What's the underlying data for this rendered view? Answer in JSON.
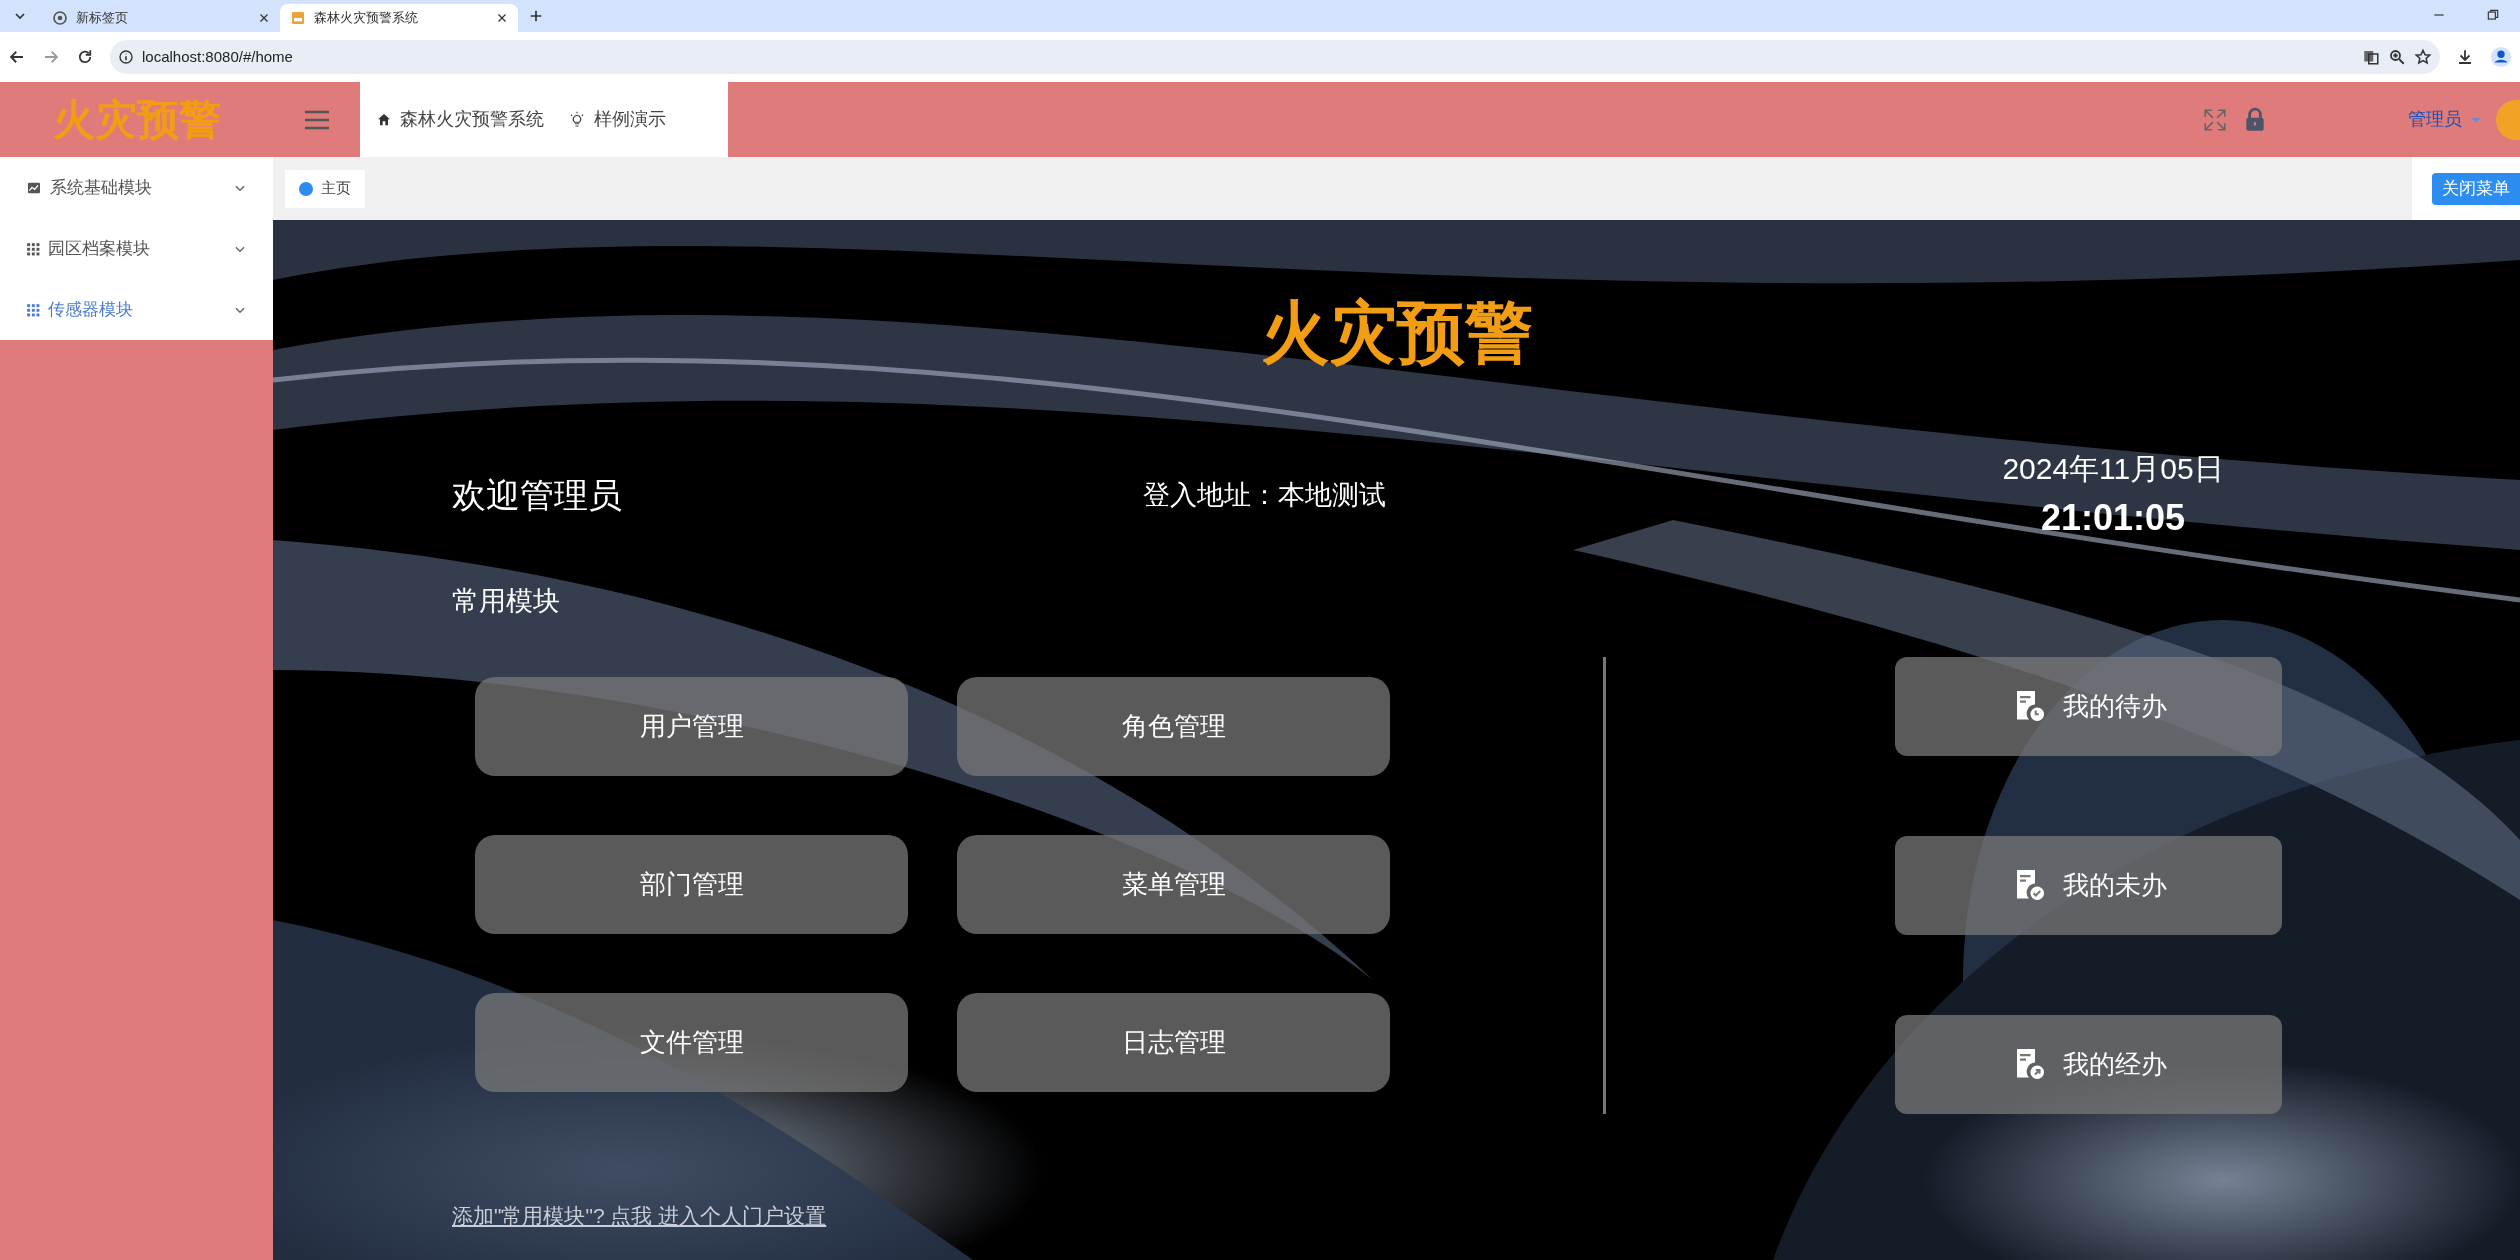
{
  "browser": {
    "tabs": [
      {
        "title": "新标签页",
        "selected": false
      },
      {
        "title": "森林火灾预警系统",
        "selected": true
      }
    ],
    "address": "localhost:8080/#/home"
  },
  "header": {
    "logo": "火灾预警",
    "tabs": [
      {
        "label": "森林火灾预警系统",
        "kind": "home"
      },
      {
        "label": "样例演示",
        "kind": "bulb"
      }
    ],
    "user": "管理员"
  },
  "tag_bar": {
    "tags": [
      {
        "label": "主页",
        "selected": true
      }
    ],
    "close_menu": "关闭菜单"
  },
  "sidebar": {
    "items": [
      {
        "label": "系统基础模块",
        "kind": "chart",
        "selected": false
      },
      {
        "label": "园区档案模块",
        "kind": "grid",
        "selected": false
      },
      {
        "label": "传感器模块",
        "kind": "grid",
        "selected": true
      }
    ]
  },
  "home": {
    "title": "火灾预警",
    "welcome": "欢迎管理员",
    "login_address": "登入地址：本地测试",
    "date": "2024年11月05日",
    "time": "21:01:05",
    "section_title": "常用模块",
    "modules": [
      "用户管理",
      "角色管理",
      "部门管理",
      "菜单管理",
      "文件管理",
      "日志管理"
    ],
    "tasks": [
      {
        "label": "我的待办",
        "kind": "clock"
      },
      {
        "label": "我的未办",
        "kind": "check"
      },
      {
        "label": "我的经办",
        "kind": "arrow"
      }
    ],
    "footer_link": "添加\"常用模块\"? 点我 进入个人门户设置"
  }
}
